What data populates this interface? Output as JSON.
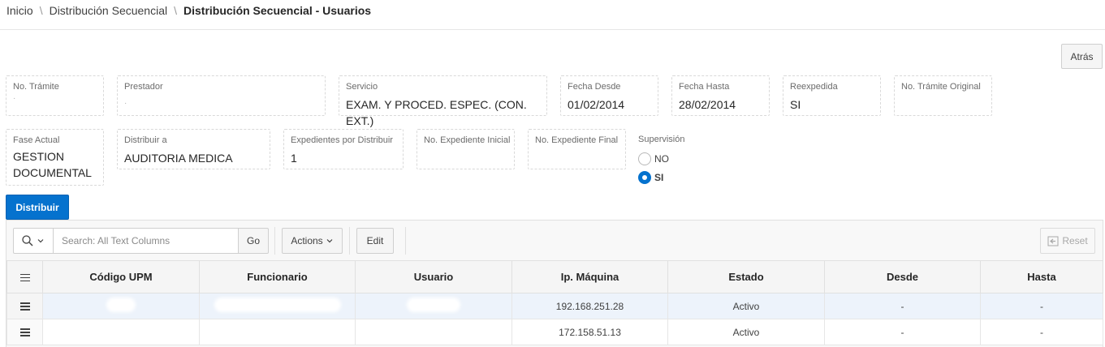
{
  "breadcrumb": {
    "items": [
      "Inicio",
      "Distribución Secuencial"
    ],
    "current": "Distribución Secuencial - Usuarios",
    "separator": "\\"
  },
  "buttons": {
    "back": "Atrás",
    "distribute": "Distribuir",
    "go": "Go",
    "actions": "Actions",
    "edit": "Edit",
    "reset": "Reset"
  },
  "fields": {
    "tramite": {
      "label": "No. Trámite",
      "value": ""
    },
    "prestador": {
      "label": "Prestador",
      "value": ""
    },
    "servicio": {
      "label": "Servicio",
      "value": "EXAM. Y PROCED. ESPEC. (CON. EXT.)"
    },
    "fecha_desde": {
      "label": "Fecha Desde",
      "value": "01/02/2014"
    },
    "fecha_hasta": {
      "label": "Fecha Hasta",
      "value": "28/02/2014"
    },
    "reexpedida": {
      "label": "Reexpedida",
      "value": "SI"
    },
    "tramite_original": {
      "label": "No. Trámite Original",
      "value": ""
    },
    "fase_actual": {
      "label": "Fase Actual",
      "value_line1": "GESTION",
      "value_line2": "DOCUMENTAL"
    },
    "distribuir_a": {
      "label": "Distribuir a",
      "value": "AUDITORIA MEDICA"
    },
    "expedientes": {
      "label": "Expedientes por Distribuir",
      "value": "1"
    },
    "exp_inicial": {
      "label": "No. Expediente Inicial",
      "value": ""
    },
    "exp_final": {
      "label": "No. Expediente Final",
      "value": ""
    }
  },
  "supervision": {
    "label": "Supervisión",
    "options": [
      "NO",
      "SI"
    ],
    "selected": "SI"
  },
  "search": {
    "placeholder": "Search: All Text Columns"
  },
  "grid": {
    "columns": [
      "Código UPM",
      "Funcionario",
      "Usuario",
      "Ip. Máquina",
      "Estado",
      "Desde",
      "Hasta"
    ],
    "rows": [
      {
        "ip": "192.168.251.28",
        "estado": "Activo",
        "desde": "-",
        "hasta": "-",
        "selected": true
      },
      {
        "ip": "172.158.51.13",
        "estado": "Activo",
        "desde": "-",
        "hasta": "-",
        "selected": false
      }
    ]
  },
  "colors": {
    "primary": "#0572ce",
    "selected_row": "#edf3fb"
  }
}
